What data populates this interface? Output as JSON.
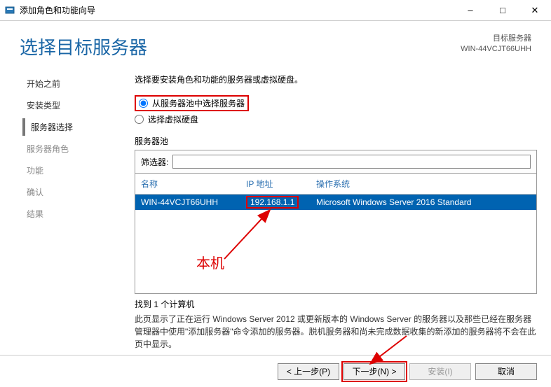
{
  "titlebar": {
    "title": "添加角色和功能向导"
  },
  "header": {
    "heading": "选择目标服务器",
    "target_label": "目标服务器",
    "target_value": "WIN-44VCJT66UHH"
  },
  "sidebar": {
    "items": [
      {
        "label": "开始之前",
        "state": "enabled"
      },
      {
        "label": "安装类型",
        "state": "enabled"
      },
      {
        "label": "服务器选择",
        "state": "selected"
      },
      {
        "label": "服务器角色",
        "state": "disabled"
      },
      {
        "label": "功能",
        "state": "disabled"
      },
      {
        "label": "确认",
        "state": "disabled"
      },
      {
        "label": "结果",
        "state": "disabled"
      }
    ]
  },
  "main": {
    "intro": "选择要安装角色和功能的服务器或虚拟硬盘。",
    "radio1": "从服务器池中选择服务器",
    "radio2": "选择虚拟硬盘",
    "pool_label": "服务器池",
    "filter_label": "筛选器:",
    "filter_value": "",
    "columns": {
      "name": "名称",
      "ip": "IP 地址",
      "os": "操作系统"
    },
    "rows": [
      {
        "name": "WIN-44VCJT66UHH",
        "ip": "192.168.1.1",
        "os": "Microsoft Windows Server 2016 Standard"
      }
    ],
    "found_text": "找到 1 个计算机",
    "desc_text": "此页显示了正在运行 Windows Server 2012 或更新版本的 Windows Server 的服务器以及那些已经在服务器管理器中使用\"添加服务器\"命令添加的服务器。脱机服务器和尚未完成数据收集的新添加的服务器将不会在此页中显示。"
  },
  "footer": {
    "prev": "< 上一步(P)",
    "next": "下一步(N) >",
    "install": "安装(I)",
    "cancel": "取消"
  },
  "annotation": {
    "local_machine": "本机"
  }
}
